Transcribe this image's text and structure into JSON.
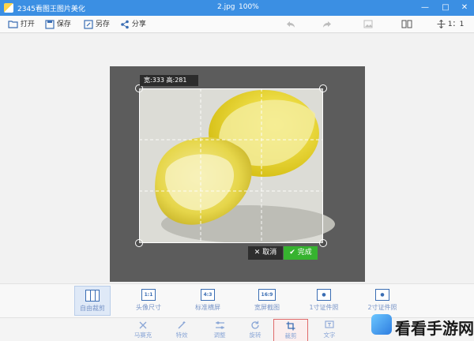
{
  "titlebar": {
    "app_title": "2345看图王图片美化",
    "doc_name": "2.jpg",
    "zoom": "100%",
    "minimize": "—",
    "restore": "□",
    "close": "✕"
  },
  "toolbar": {
    "open": "打开",
    "save": "保存",
    "save_as": "另存",
    "share": "分享",
    "undo": "",
    "redo": "",
    "compare": "",
    "ratio_label": "1：1"
  },
  "crop": {
    "size_label": "宽:333  高:281",
    "cancel": "取消",
    "done": "完成"
  },
  "ratio_panel": {
    "items": [
      {
        "box": "",
        "label": "自由裁剪"
      },
      {
        "box": "1:1",
        "label": "头像尺寸"
      },
      {
        "box": "4:3",
        "label": "标准横屏"
      },
      {
        "box": "16:9",
        "label": "宽屏截图"
      },
      {
        "box": "",
        "label": "1寸证件照"
      },
      {
        "box": "",
        "label": "2寸证件照"
      }
    ]
  },
  "bottom_tools": {
    "items": [
      {
        "label": "马赛克",
        "icon": "mosaic-icon"
      },
      {
        "label": "特效",
        "icon": "magic-wand-icon"
      },
      {
        "label": "调整",
        "icon": "sliders-icon"
      },
      {
        "label": "旋转",
        "icon": "rotate-icon"
      },
      {
        "label": "裁剪",
        "icon": "crop-icon"
      },
      {
        "label": "文字",
        "icon": "text-icon"
      }
    ]
  },
  "watermark": {
    "text": "看看手游网"
  },
  "colors": {
    "titlebar": "#3b8fe3",
    "done_button": "#36b32f",
    "active_tool_border": "#e06a6a"
  }
}
